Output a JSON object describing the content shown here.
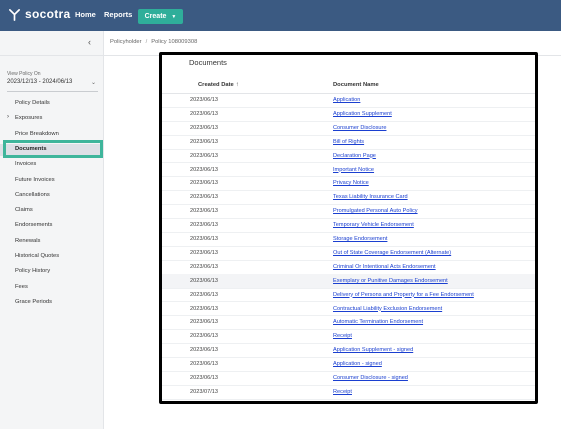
{
  "app": {
    "logo_text": "socotra",
    "nav": {
      "home": "Home",
      "reports": "Reports",
      "create": "Create"
    }
  },
  "sidebar": {
    "collapse_glyph": "‹",
    "view_policy_label": "View Policy On",
    "view_policy_value": "2023/12/13 - 2024/06/13",
    "items": [
      {
        "label": "Policy Details"
      },
      {
        "label": "Exposures",
        "expandable": true
      },
      {
        "label": "Price Breakdown"
      },
      {
        "label": "Documents",
        "active": true
      },
      {
        "label": "Invoices"
      },
      {
        "label": "Future Invoices"
      },
      {
        "label": "Cancellations"
      },
      {
        "label": "Claims"
      },
      {
        "label": "Endorsements"
      },
      {
        "label": "Renewals"
      },
      {
        "label": "Historical Quotes"
      },
      {
        "label": "Policy History"
      },
      {
        "label": "Fees"
      },
      {
        "label": "Grace Periods"
      }
    ]
  },
  "breadcrumb": {
    "parent": "Policyholder",
    "current": "Policy 108009308"
  },
  "documents": {
    "title": "Documents",
    "columns": {
      "date": "Created Date",
      "name": "Document Name"
    },
    "rows": [
      {
        "date": "2023/06/13",
        "name": "Application"
      },
      {
        "date": "2023/06/13",
        "name": "Application Supplement"
      },
      {
        "date": "2023/06/13",
        "name": "Consumer Disclosure"
      },
      {
        "date": "2023/06/13",
        "name": "Bill of Rights"
      },
      {
        "date": "2023/06/13",
        "name": "Declaration Page"
      },
      {
        "date": "2023/06/13",
        "name": "Important Notice"
      },
      {
        "date": "2023/06/13",
        "name": "Privacy Notice"
      },
      {
        "date": "2023/06/13",
        "name": "Texas Liability Insurance Card"
      },
      {
        "date": "2023/06/13",
        "name": "Promulgated Personal Auto Policy"
      },
      {
        "date": "2023/06/13",
        "name": "Temporary Vehicle Endorsement"
      },
      {
        "date": "2023/06/13",
        "name": "Storage Endorsement"
      },
      {
        "date": "2023/06/13",
        "name": "Out of State Coverage Endorsement (Alternate)"
      },
      {
        "date": "2023/06/13",
        "name": "Criminal Or Intentional Acts Endorsement"
      },
      {
        "date": "2023/06/13",
        "name": "Exemplary or Punitive Damages Endorsement"
      },
      {
        "date": "2023/06/13",
        "name": "Delivery of Persons and Property for a Fee Endorsement"
      },
      {
        "date": "2023/06/13",
        "name": "Contractual Liability Exclusion Endorsement"
      },
      {
        "date": "2023/06/13",
        "name": "Automatic Termination Endorsement"
      },
      {
        "date": "2023/06/13",
        "name": "Receipt"
      },
      {
        "date": "2023/06/13",
        "name": "Application Supplement - signed"
      },
      {
        "date": "2023/06/13",
        "name": "Application - signed"
      },
      {
        "date": "2023/06/13",
        "name": "Consumer Disclosure - signed"
      },
      {
        "date": "2023/07/13",
        "name": "Receipt"
      }
    ]
  },
  "colors": {
    "topbar": "#3b5a82",
    "create_button": "#2fae9a",
    "highlight": "#3eb59b",
    "link": "#1a3fd0"
  }
}
